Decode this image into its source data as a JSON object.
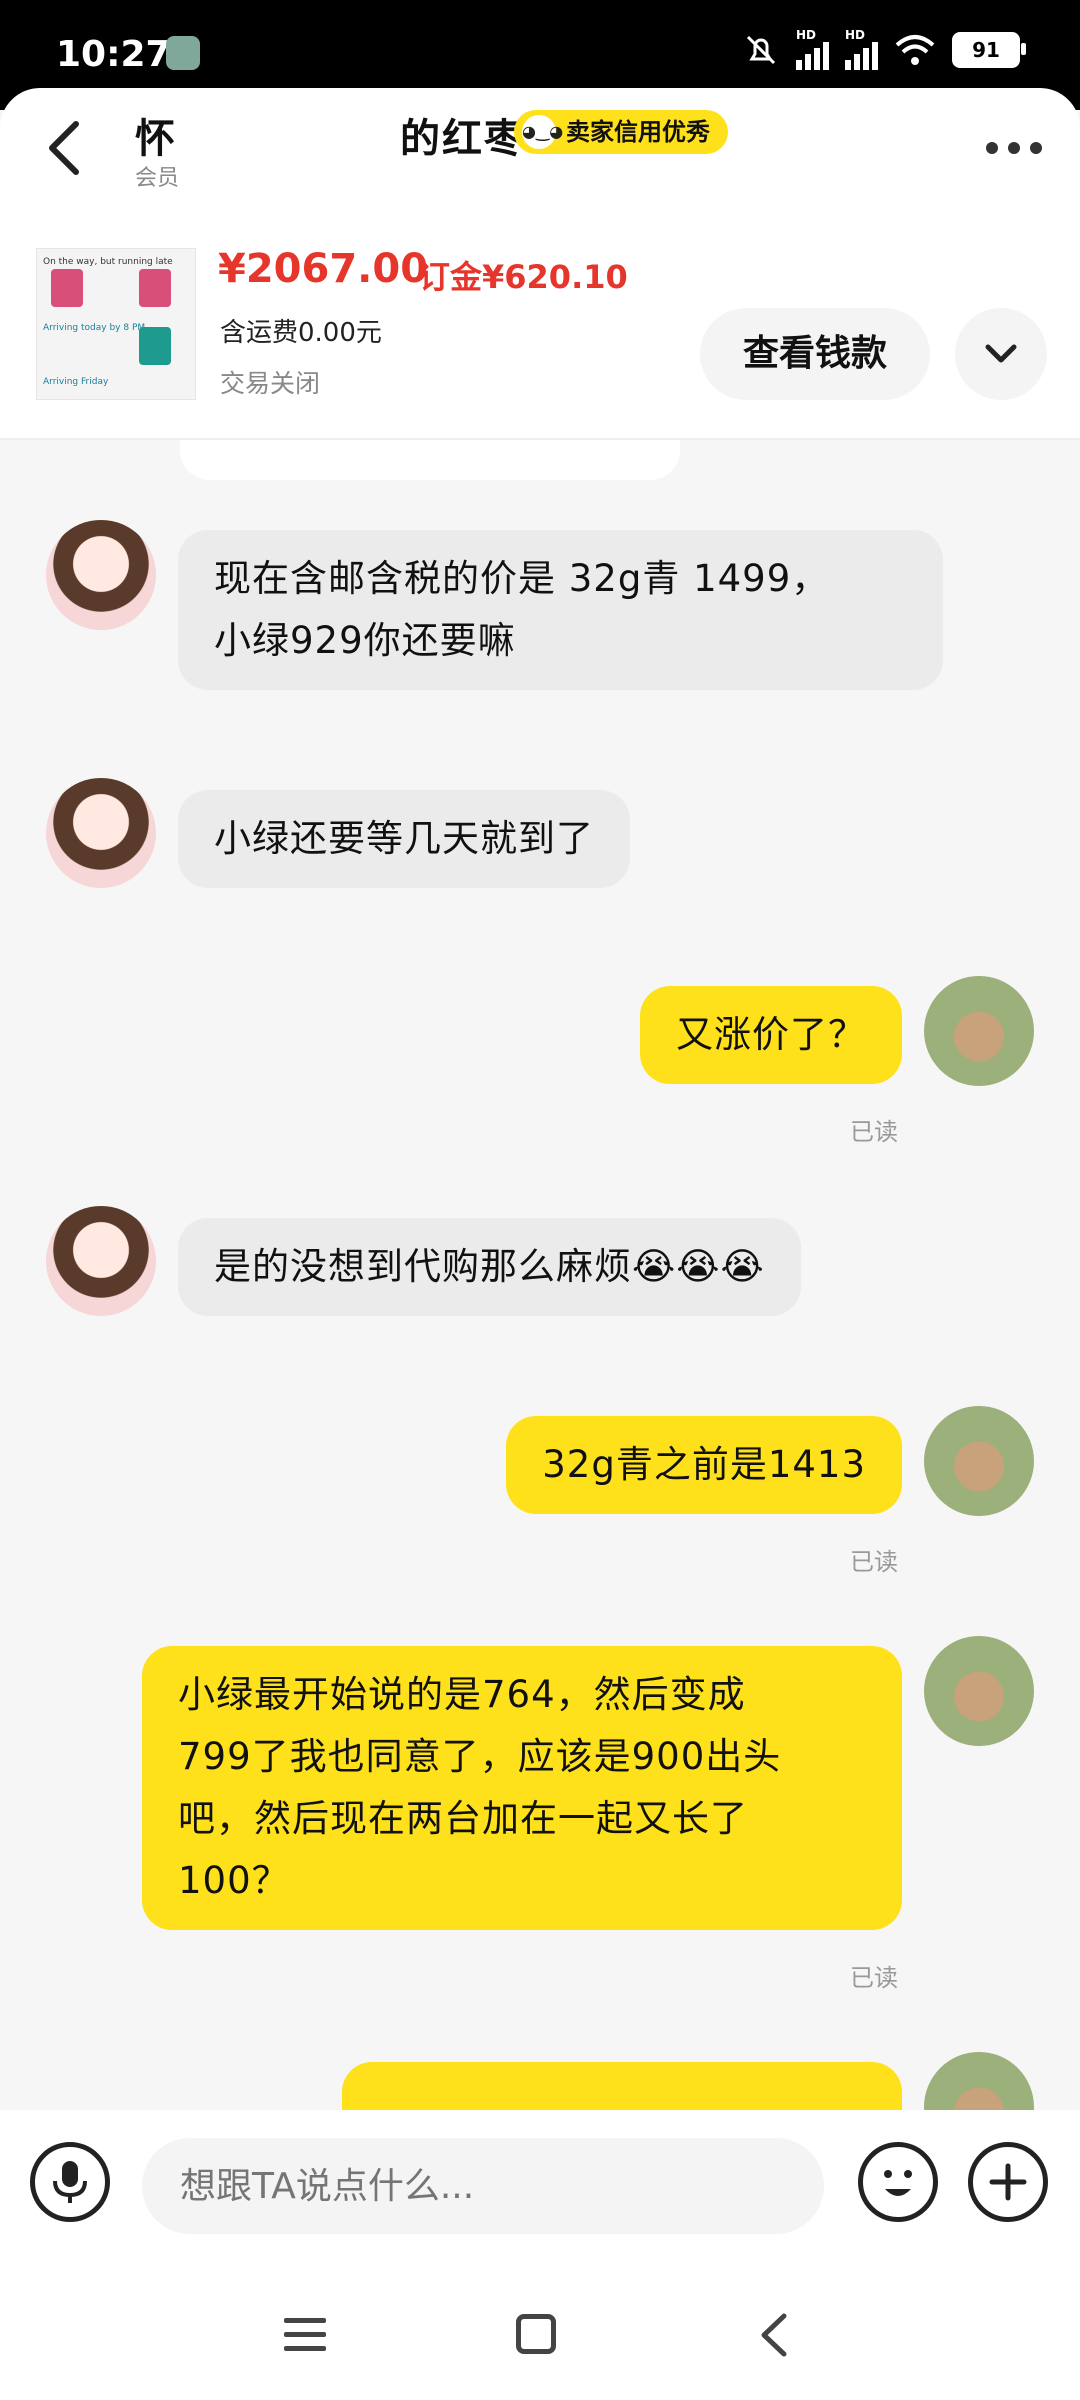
{
  "status_bar": {
    "time": "10:27",
    "battery": "91",
    "network_label": "HD"
  },
  "header": {
    "title_prefix": "怀",
    "title_suffix": "的红枣",
    "subtitle": "会员",
    "seller_badge": "卖家信用优秀"
  },
  "product": {
    "thumbnail_header": "On the way, but running late",
    "thumbnail_row1": "Arriving today by 8 PM",
    "thumbnail_row2": "Arriving Friday",
    "price": "¥2067.00",
    "deposit": "订金¥620.10",
    "shipping": "含运费0.00元",
    "status": "交易关闭",
    "view_button": "查看钱款"
  },
  "messages": [
    {
      "side": "in",
      "text_line1": "现在含邮含税的价是 32g青 1499，",
      "text_line2": "小绿929你还要嘛"
    },
    {
      "side": "in",
      "text": "小绿还要等几天就到了"
    },
    {
      "side": "out",
      "text": "又涨价了？",
      "read": "已读"
    },
    {
      "side": "in",
      "text": "是的没想到代购那么麻烦😭😭😭"
    },
    {
      "side": "out",
      "text": "32g青之前是1413",
      "read": "已读"
    },
    {
      "side": "out",
      "line1": "小绿最开始说的是764，然后变成",
      "line2": "799了我也同意了，应该是900出头",
      "line3": "吧，然后现在两台加在一起又长了",
      "line4": "100？",
      "read": "已读"
    }
  ],
  "input": {
    "placeholder": "想跟TA说点什么..."
  }
}
